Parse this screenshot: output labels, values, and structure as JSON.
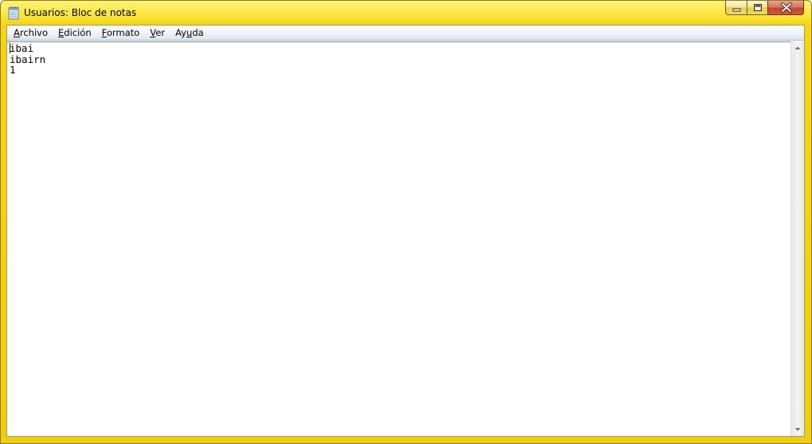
{
  "window": {
    "title": "Usuarios: Bloc de notas"
  },
  "caption_buttons": {
    "minimize_icon": "minimize-icon",
    "maximize_icon": "restore-icon",
    "close_icon": "close-icon"
  },
  "menu": {
    "items": [
      {
        "accel": "A",
        "rest": "rchivo"
      },
      {
        "accel": "E",
        "rest": "dición"
      },
      {
        "accel": "F",
        "rest": "ormato"
      },
      {
        "accel": "V",
        "rest": "er"
      },
      {
        "pre": "Ay",
        "accel": "u",
        "rest": "da"
      }
    ]
  },
  "document": {
    "lines": [
      "ibai",
      "ibairn",
      "1"
    ]
  },
  "colors": {
    "frame": "#f4d51a",
    "close_button": "#c24630",
    "menubar": "#eef1f7"
  }
}
